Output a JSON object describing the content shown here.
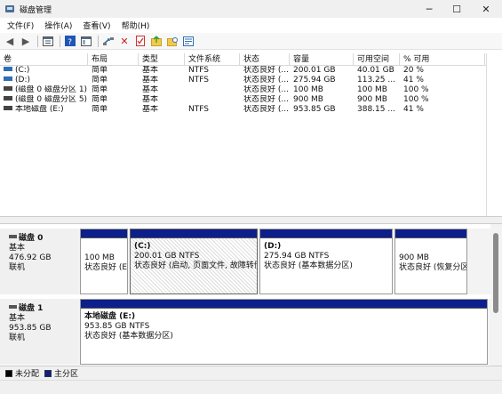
{
  "window": {
    "title": "磁盘管理",
    "minimize": "─",
    "maximize": "☐",
    "close": "✕"
  },
  "menu": [
    "文件(F)",
    "操作(A)",
    "查看(V)",
    "帮助(H)"
  ],
  "toolbar_icons": [
    "back-arrow-icon",
    "forward-arrow-icon",
    "properties-icon",
    "help-icon",
    "view-icon",
    "connect-icon",
    "delete-icon",
    "checkmark-icon",
    "folder-up-icon",
    "folder-search-icon",
    "refresh-icon"
  ],
  "columns": [
    "卷",
    "布局",
    "类型",
    "文件系统",
    "状态",
    "容量",
    "可用空间",
    "% 可用"
  ],
  "volumes": [
    {
      "name": "(C:)",
      "layout": "简单",
      "type": "基本",
      "fs": "NTFS",
      "status": "状态良好 (...",
      "capacity": "200.01 GB",
      "free": "40.01 GB",
      "pct": "20 %",
      "icon_color": "#2f6fb3"
    },
    {
      "name": "(D:)",
      "layout": "简单",
      "type": "基本",
      "fs": "NTFS",
      "status": "状态良好 (...",
      "capacity": "275.94 GB",
      "free": "113.25 ...",
      "pct": "41 %",
      "icon_color": "#2f6fb3"
    },
    {
      "name": "(磁盘 0 磁盘分区 1)",
      "layout": "简单",
      "type": "基本",
      "fs": "",
      "status": "状态良好 (...",
      "capacity": "100 MB",
      "free": "100 MB",
      "pct": "100 %",
      "icon_color": "#444444"
    },
    {
      "name": "(磁盘 0 磁盘分区 5)",
      "layout": "简单",
      "type": "基本",
      "fs": "",
      "status": "状态良好 (...",
      "capacity": "900 MB",
      "free": "900 MB",
      "pct": "100 %",
      "icon_color": "#444444"
    },
    {
      "name": "本地磁盘 (E:)",
      "layout": "简单",
      "type": "基本",
      "fs": "NTFS",
      "status": "状态良好 (...",
      "capacity": "953.85 GB",
      "free": "388.15 ...",
      "pct": "41 %",
      "icon_color": "#444444"
    }
  ],
  "disks": [
    {
      "name": "磁盘 0",
      "type": "基本",
      "size": "476.92 GB",
      "state": "联机",
      "partitions": [
        {
          "title": "",
          "size": "100 MB",
          "status": "状态良好 (E"
        },
        {
          "title": "(C:)",
          "size": "200.01 GB NTFS",
          "status": "状态良好 (启动, 页面文件, 故障转储"
        },
        {
          "title": "(D:)",
          "size": "275.94 GB NTFS",
          "status": "状态良好 (基本数据分区)"
        },
        {
          "title": "",
          "size": "900 MB",
          "status": "状态良好 (恢复分区"
        }
      ]
    },
    {
      "name": "磁盘 1",
      "type": "基本",
      "size": "953.85 GB",
      "state": "联机",
      "partitions": [
        {
          "title": "本地磁盘  (E:)",
          "size": "953.85 GB NTFS",
          "status": "状态良好 (基本数据分区)"
        }
      ]
    }
  ],
  "legend": [
    {
      "label": "未分配",
      "color": "#000000"
    },
    {
      "label": "主分区",
      "color": "#0d1f8a"
    }
  ]
}
